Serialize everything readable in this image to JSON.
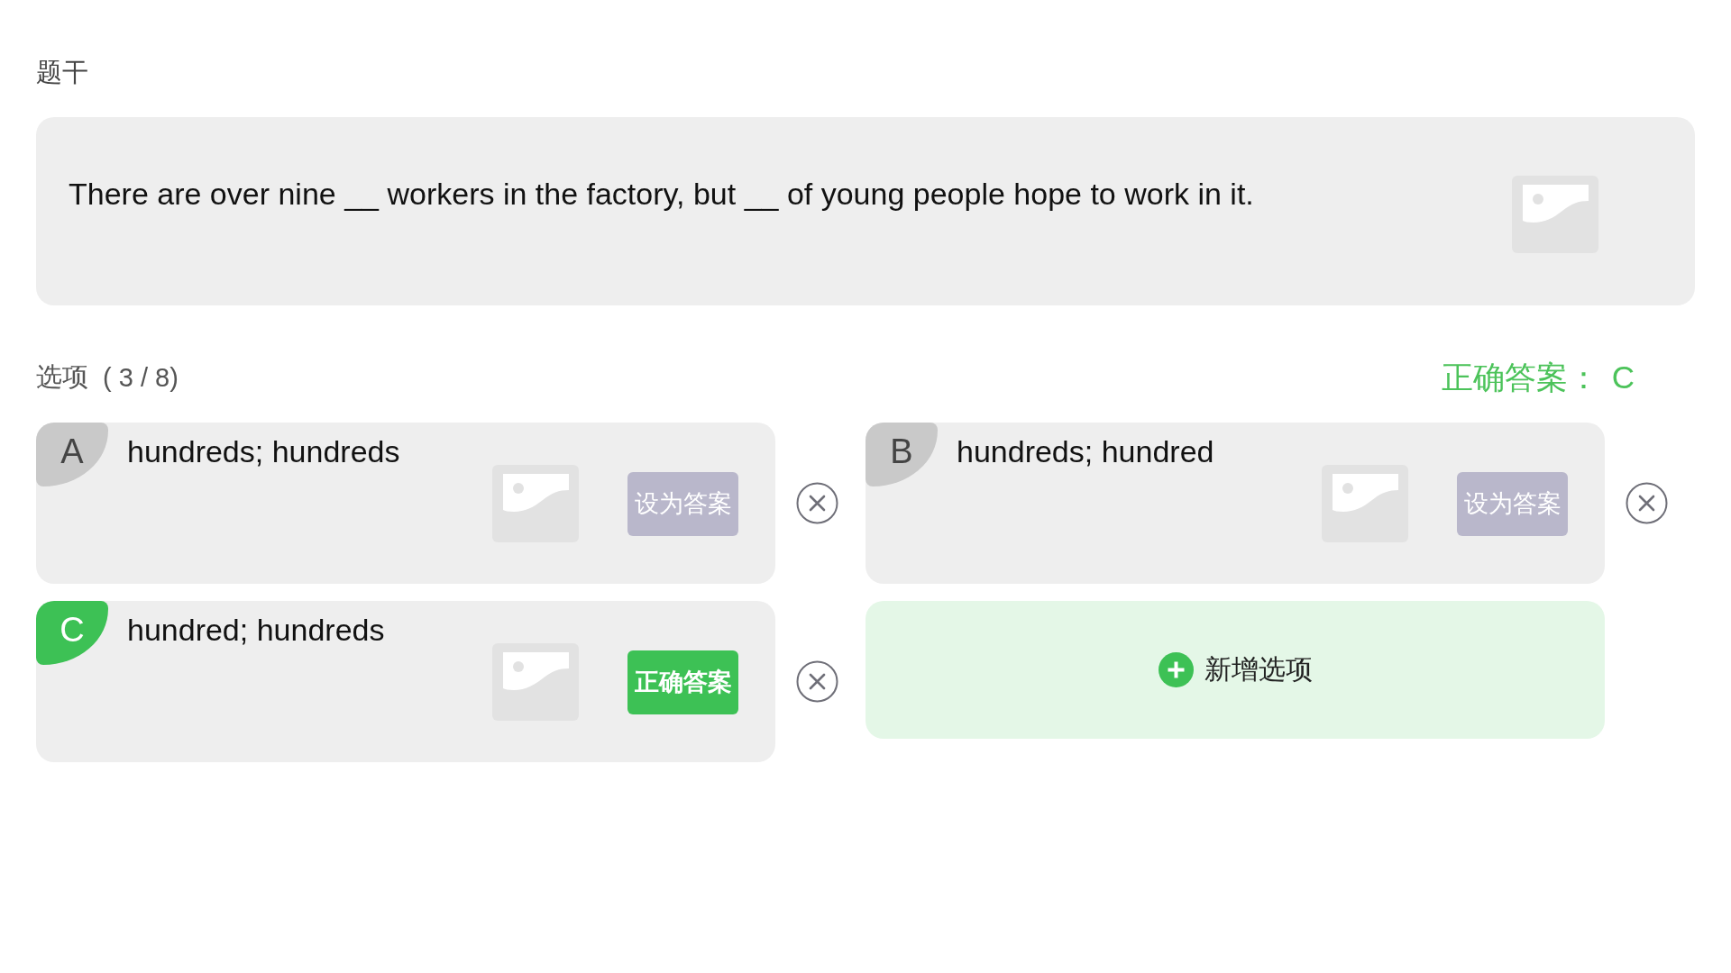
{
  "stem": {
    "label": "题干",
    "text": "There are over nine __ workers in the factory, but __ of young people hope to work in it."
  },
  "options_header": {
    "label": "选项",
    "count": "( 3 / 8)"
  },
  "correct_answer": {
    "label": "正确答案：",
    "value": "C"
  },
  "options": [
    {
      "letter": "A",
      "text": "hundreds; hundreds",
      "selected": false,
      "button": "设为答案"
    },
    {
      "letter": "B",
      "text": "hundreds; hundred",
      "selected": false,
      "button": "设为答案"
    },
    {
      "letter": "C",
      "text": "hundred; hundreds",
      "selected": true,
      "button": "正确答案"
    }
  ],
  "add_option": {
    "label": "新增选项"
  }
}
